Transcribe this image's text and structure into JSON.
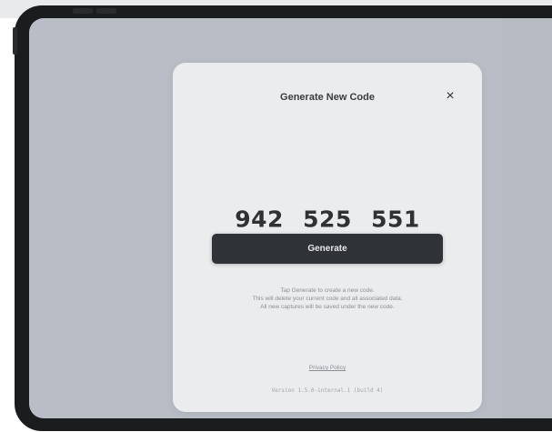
{
  "modal": {
    "title": "Generate New Code",
    "close_icon": "×",
    "code_groups": [
      "942",
      "525",
      "551"
    ],
    "generate_label": "Generate",
    "info_lines": [
      "Tap Generate to create a new code.",
      "This will delete your current code and all associated data.",
      "All new captures will be saved under the new code."
    ],
    "privacy_label": "Privacy Policy",
    "version_label": "Version 1.5.0-internal.1 (build 4)"
  },
  "icons": {
    "close": "close-icon"
  },
  "colors": {
    "screen_background": "#b6bbc3",
    "modal_background": "#ebecee",
    "button_background": "#2f3337",
    "device_frame": "#1b1c1e"
  }
}
